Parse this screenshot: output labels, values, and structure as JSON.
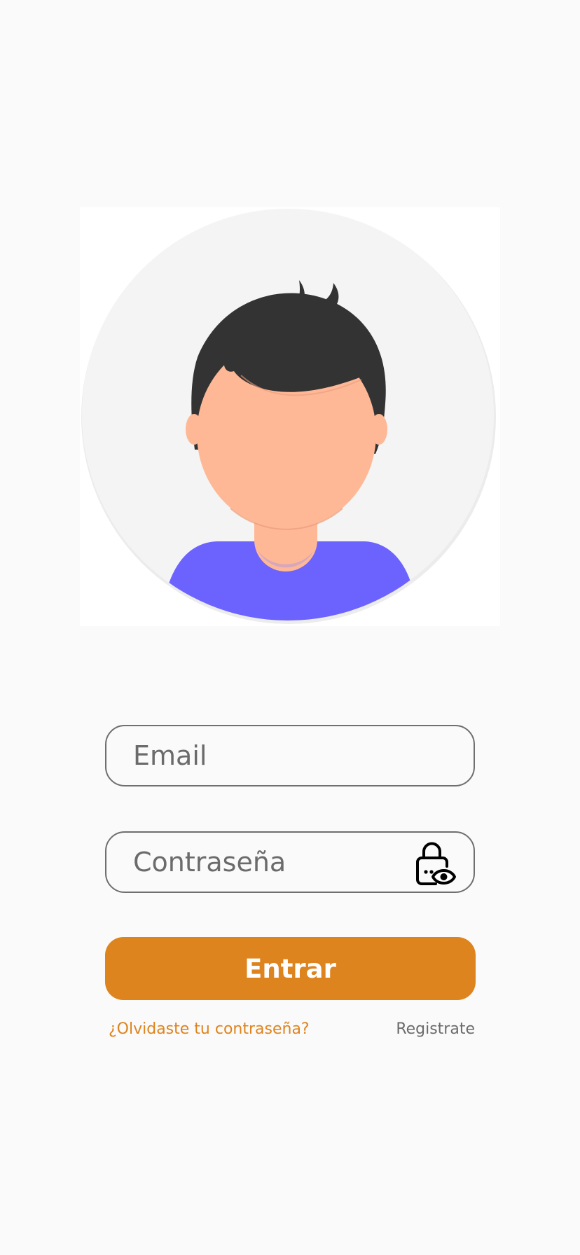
{
  "app": {
    "accent_color": "#de841e",
    "background_color": "#fafafa"
  },
  "avatar": {
    "icon": "user-avatar-illustration",
    "shirt_color": "#6c63ff",
    "skin_color": "#ffb896",
    "hair_color": "#333333"
  },
  "login_form": {
    "email": {
      "placeholder": "Email",
      "value": ""
    },
    "password": {
      "placeholder": "Contraseña",
      "value": "",
      "toggle_icon": "lock-eye-icon"
    },
    "submit_label": "Entrar",
    "forgot_password_label": "¿Olvidaste tu contraseña?",
    "register_label": "Registrate"
  }
}
